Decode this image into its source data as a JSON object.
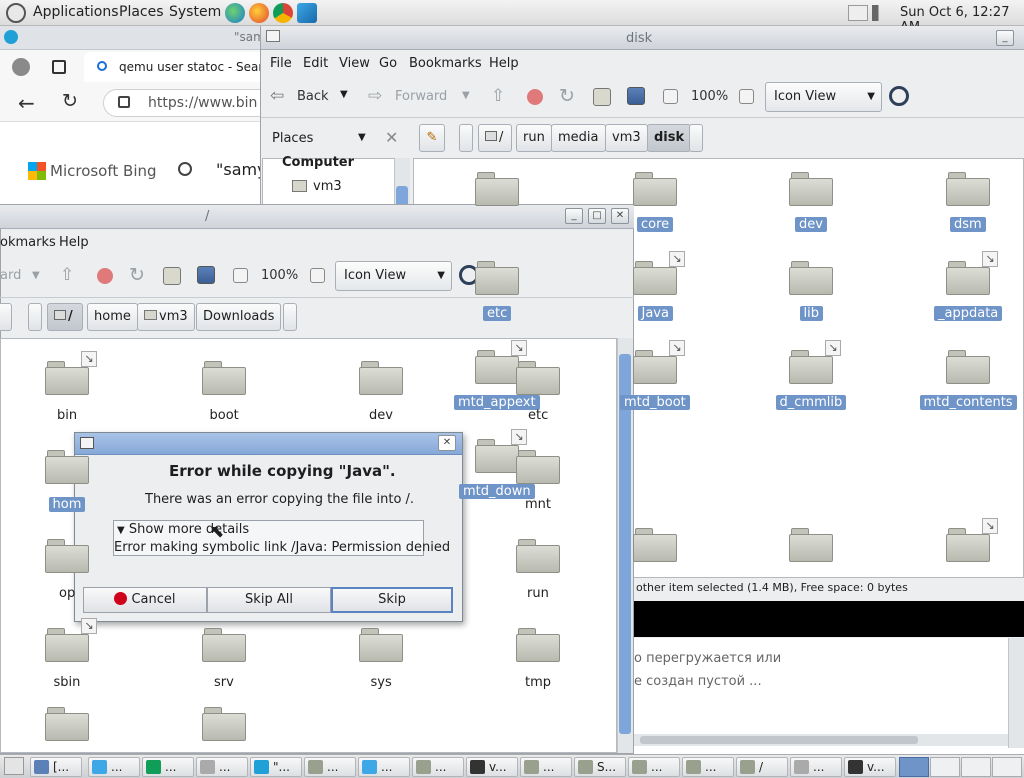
{
  "top_panel": {
    "menus": [
      "Applications",
      "Places",
      "System"
    ],
    "clock": "Sun Oct  6, 12:27 AM"
  },
  "browser": {
    "tab_title": "\"sam",
    "tab2_title": "qemu user statoc - Sear",
    "url": "https://www.bin",
    "brand": "Microsoft Bing",
    "search_text": "\"samy"
  },
  "disk_window": {
    "title": "disk",
    "menus": [
      "File",
      "Edit",
      "View",
      "Go",
      "Bookmarks",
      "Help"
    ],
    "toolbar": {
      "back": "Back",
      "forward": "Forward",
      "zoom": "100%",
      "view_mode": "Icon View"
    },
    "places_label": "Places",
    "breadcrumbs": [
      "/",
      "run",
      "media",
      "vm3",
      "disk"
    ],
    "sidebar": {
      "header": "Computer",
      "item": "vm3"
    },
    "items": [
      {
        "label": "",
        "selected": false,
        "link": false
      },
      {
        "label": "core",
        "selected": true,
        "link": false
      },
      {
        "label": "dev",
        "selected": true,
        "link": false
      },
      {
        "label": "dsm",
        "selected": true,
        "link": false
      },
      {
        "label": "etc",
        "selected": true,
        "link": false
      },
      {
        "label": "Java",
        "selected": true,
        "link": true
      },
      {
        "label": "lib",
        "selected": true,
        "link": false
      },
      {
        "label": "_appdata",
        "selected": true,
        "link": true
      },
      {
        "label": "mtd_appext",
        "selected": true,
        "link": true
      },
      {
        "label": "mtd_boot",
        "selected": true,
        "link": true
      },
      {
        "label": "d_cmmlib",
        "selected": true,
        "link": true
      },
      {
        "label": "mtd_contents",
        "selected": true,
        "link": false
      },
      {
        "label": "mtd_down",
        "selected": true,
        "link": true
      }
    ],
    "status": "other item selected (1.4 MB), Free space: 0 bytes"
  },
  "background_text": [
    "о перегружается или",
    "е создан пустой ..."
  ],
  "root_window": {
    "title": "/",
    "menus": [
      "okmarks",
      "Help"
    ],
    "toolbar": {
      "forward_partial": "ard",
      "zoom": "100%",
      "view_mode": "Icon View"
    },
    "breadcrumbs": [
      "/",
      "home",
      "vm3",
      "Downloads"
    ],
    "items": [
      {
        "label": "bin",
        "selected": false
      },
      {
        "label": "boot",
        "selected": false
      },
      {
        "label": "dev",
        "selected": false
      },
      {
        "label": "etc",
        "selected": false
      },
      {
        "label": "hom",
        "selected": true
      },
      {
        "label": "mnt",
        "selected": false
      },
      {
        "label": "op",
        "selected": false
      },
      {
        "label": "run",
        "selected": false
      },
      {
        "label": "sbin",
        "selected": false
      },
      {
        "label": "srv",
        "selected": false
      },
      {
        "label": "sys",
        "selected": false
      },
      {
        "label": "tmp",
        "selected": false
      }
    ]
  },
  "dialog": {
    "heading": "Error while copying \"Java\".",
    "message": "There was an error copying the file into /.",
    "details_toggle": "Show more details",
    "details_text": "Error making symbolic link /Java: Permission denied",
    "buttons": {
      "cancel": "Cancel",
      "skip_all": "Skip All",
      "skip": "Skip"
    }
  },
  "taskbar": {
    "tasks": [
      "[...",
      "...",
      "...",
      "...",
      "\"...",
      "...",
      "...",
      "...",
      "v...",
      "...",
      "S...",
      "...",
      "...",
      "/",
      "...",
      "v..."
    ]
  },
  "colors": {
    "selection": "#6f94c8",
    "scroll_thumb": "#7ea6da",
    "cancel_red": "#d0021b"
  }
}
